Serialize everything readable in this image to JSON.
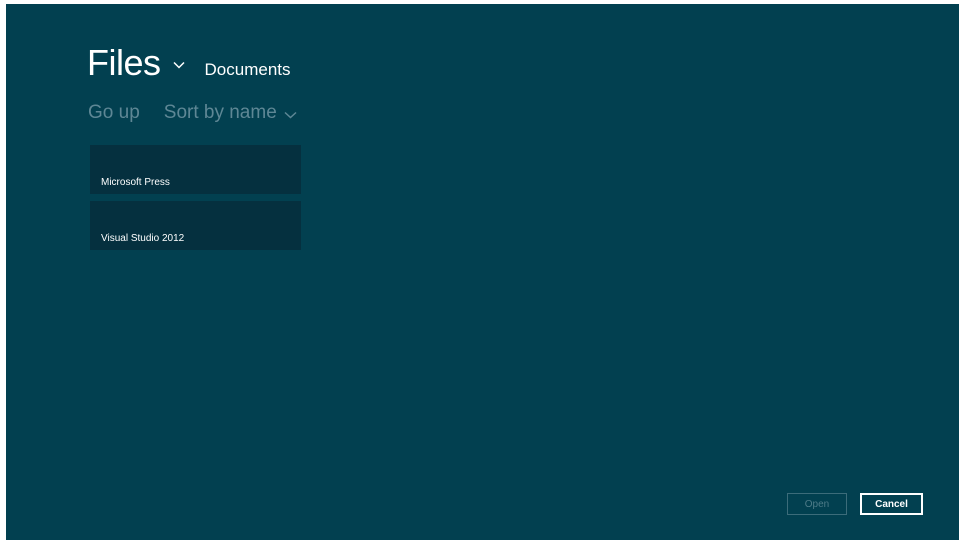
{
  "header": {
    "title": "Files",
    "title_chevron_icon": "chevron-down-icon",
    "location": "Documents"
  },
  "commands": {
    "go_up": "Go up",
    "sort_label": "Sort by name",
    "sort_chevron_icon": "chevron-down-icon"
  },
  "items": [
    {
      "label": "Microsoft Press"
    },
    {
      "label": "Visual Studio 2012"
    }
  ],
  "footer": {
    "open_label": "Open",
    "cancel_label": "Cancel"
  },
  "colors": {
    "background": "#024050",
    "tile": "#05303f",
    "disabled_text": "#5e8795"
  }
}
